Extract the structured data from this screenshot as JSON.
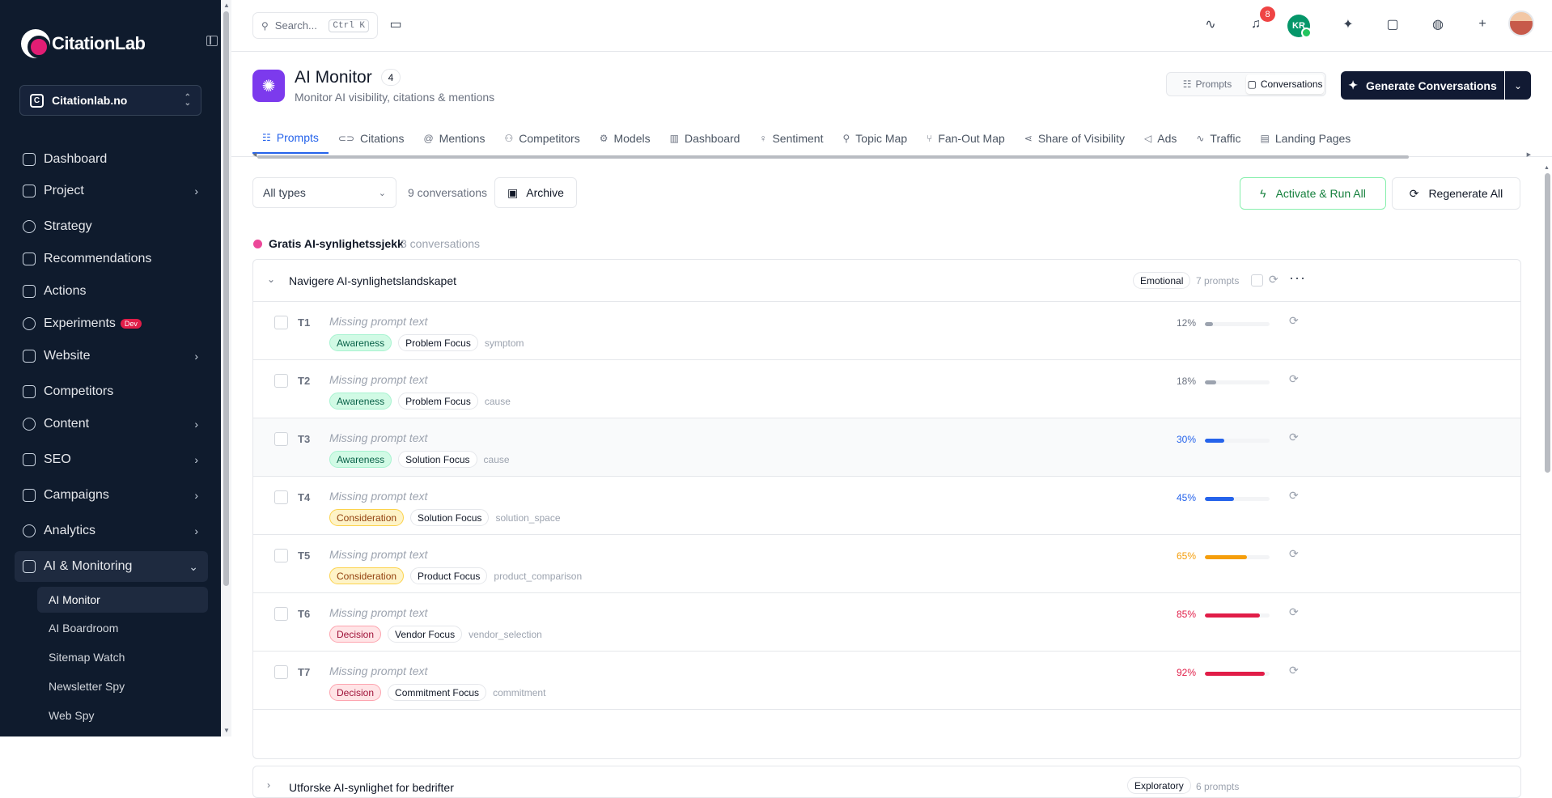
{
  "brand": {
    "name": "CitationLab"
  },
  "project": {
    "name": "Citationlab.no"
  },
  "sidebar": {
    "items": [
      {
        "label": "Dashboard",
        "chevron": false
      },
      {
        "label": "Project",
        "chevron": true
      },
      {
        "label": "Strategy",
        "chevron": false
      },
      {
        "label": "Recommendations",
        "chevron": false
      },
      {
        "label": "Actions",
        "chevron": false
      },
      {
        "label": "Experiments",
        "chevron": false,
        "badge": "Dev"
      },
      {
        "label": "Website",
        "chevron": true
      },
      {
        "label": "Competitors",
        "chevron": false
      },
      {
        "label": "Content",
        "chevron": true
      },
      {
        "label": "SEO",
        "chevron": true
      },
      {
        "label": "Campaigns",
        "chevron": true
      },
      {
        "label": "Analytics",
        "chevron": true
      },
      {
        "label": "AI & Monitoring",
        "chevron": true,
        "expanded": true
      }
    ],
    "subitems": [
      {
        "label": "AI Monitor",
        "active": true
      },
      {
        "label": "AI Boardroom"
      },
      {
        "label": "Sitemap Watch"
      },
      {
        "label": "Newsletter Spy"
      },
      {
        "label": "Web Spy"
      }
    ]
  },
  "topbar": {
    "search_placeholder": "Search...",
    "shortcut": "Ctrl K",
    "notifications_count": "8",
    "user_initials": "KR"
  },
  "page": {
    "title": "AI Monitor",
    "count": "4",
    "subtitle": "Monitor AI visibility, citations & mentions",
    "view_toggle": {
      "prompts": "Prompts",
      "conversations": "Conversations"
    },
    "generate_label": "Generate Conversations"
  },
  "tabs": [
    {
      "label": "Prompts",
      "icon": "☷",
      "active": true
    },
    {
      "label": "Citations",
      "icon": "⊂⊃"
    },
    {
      "label": "Mentions",
      "icon": "@"
    },
    {
      "label": "Competitors",
      "icon": "⚇"
    },
    {
      "label": "Models",
      "icon": "⚙"
    },
    {
      "label": "Dashboard",
      "icon": "▥"
    },
    {
      "label": "Sentiment",
      "icon": "♀"
    },
    {
      "label": "Topic Map",
      "icon": "⚲"
    },
    {
      "label": "Fan-Out Map",
      "icon": "⑂"
    },
    {
      "label": "Share of Visibility",
      "icon": "⋖"
    },
    {
      "label": "Ads",
      "icon": "◁"
    },
    {
      "label": "Traffic",
      "icon": "∿"
    },
    {
      "label": "Landing Pages",
      "icon": "▤"
    }
  ],
  "toolbar": {
    "filter_value": "All types",
    "conversation_count": "9 conversations",
    "archive_label": "Archive",
    "run_all_label": "Activate & Run All",
    "regenerate_label": "Regenerate All"
  },
  "group": {
    "title": "Gratis AI-synlighetssjekk",
    "count": "3 conversations",
    "color": "#ec4899"
  },
  "conversation": {
    "title": "Navigere AI-synlighetslandskapet",
    "type": "Emotional",
    "prompts_count": "7 prompts",
    "rows": [
      {
        "id": "T1",
        "text": "Missing prompt text",
        "stage": "Awareness",
        "focus": "Problem Focus",
        "keyword": "symptom",
        "pct_label": "12%",
        "pct": 12,
        "color": "#9ca3af"
      },
      {
        "id": "T2",
        "text": "Missing prompt text",
        "stage": "Awareness",
        "focus": "Problem Focus",
        "keyword": "cause",
        "pct_label": "18%",
        "pct": 18,
        "color": "#9ca3af"
      },
      {
        "id": "T3",
        "text": "Missing prompt text",
        "stage": "Awareness",
        "focus": "Solution Focus",
        "keyword": "cause",
        "pct_label": "30%",
        "pct": 30,
        "color": "#2563eb"
      },
      {
        "id": "T4",
        "text": "Missing prompt text",
        "stage": "Consideration",
        "focus": "Solution Focus",
        "keyword": "solution_space",
        "pct_label": "45%",
        "pct": 45,
        "color": "#2563eb"
      },
      {
        "id": "T5",
        "text": "Missing prompt text",
        "stage": "Consideration",
        "focus": "Product Focus",
        "keyword": "product_comparison",
        "pct_label": "65%",
        "pct": 65,
        "color": "#f59e0b"
      },
      {
        "id": "T6",
        "text": "Missing prompt text",
        "stage": "Decision",
        "focus": "Vendor Focus",
        "keyword": "vendor_selection",
        "pct_label": "85%",
        "pct": 85,
        "color": "#e11d48"
      },
      {
        "id": "T7",
        "text": "Missing prompt text",
        "stage": "Decision",
        "focus": "Commitment Focus",
        "keyword": "commitment",
        "pct_label": "92%",
        "pct": 92,
        "color": "#e11d48"
      }
    ]
  },
  "next_conversation": {
    "title": "Utforske AI-synlighet for bedrifter",
    "type": "Exploratory",
    "prompts_count": "6 prompts"
  }
}
